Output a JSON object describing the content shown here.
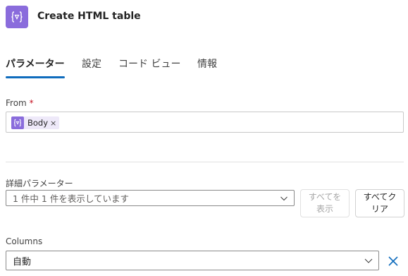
{
  "action": {
    "title": "Create HTML table",
    "icon": "variable-expression-icon"
  },
  "tabs": [
    {
      "label": "パラメーター",
      "active": true
    },
    {
      "label": "設定",
      "active": false
    },
    {
      "label": "コード ビュー",
      "active": false
    },
    {
      "label": "情報",
      "active": false
    }
  ],
  "from_field": {
    "label": "From",
    "required_mark": "*",
    "token": {
      "label": "Body",
      "remove": "×",
      "icon": "variable-expression-icon"
    }
  },
  "advanced": {
    "label": "詳細パラメーター",
    "select_value": "1 件中 1 件を表示しています",
    "show_all_button": "すべてを\n表示",
    "clear_all_button": "すべてクリア",
    "show_all_line1": "すべてを",
    "show_all_line2": "表示",
    "clear_all_line1": "すべてク",
    "clear_all_line2": "リア"
  },
  "columns": {
    "label": "Columns",
    "select_value": "自動"
  },
  "colors": {
    "accent": "#0f6cbd",
    "icon_bg": "#8a6cdc",
    "token_bg": "#eee9f9",
    "required": "#c50f1f"
  }
}
